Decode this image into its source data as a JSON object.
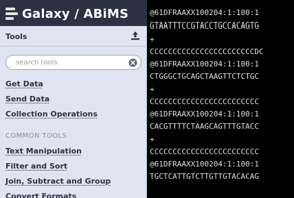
{
  "masthead": {
    "brand": "Galaxy / ABiMS"
  },
  "tool_panel": {
    "title": "Tools",
    "search": {
      "placeholder": "search tools",
      "value": ""
    },
    "links": [
      "Get Data",
      "Send Data",
      "Collection Operations"
    ],
    "section": "COMMON TOOLS",
    "common_tools": [
      "Text Manipulation",
      "Filter and Sort",
      "Join, Subtract and Group",
      "Convert Formats"
    ]
  },
  "dataset": {
    "lines": [
      "@61DFRAAXX100204:1:100:1",
      "GTAATTTCCGTACCTGCCACAGTG",
      "+",
      "CCCCCCCCCCCCCCCCCCCCCCCDC",
      "@61DFRAAXX100204:1:100:1",
      "CTGGGCTGCAGCTAAGTTCTCTGC",
      "+",
      "CCCCCCCCCCCCCCCCCCCCCCCC",
      "@61DFRAAXX100204:1:100:1",
      "CACGTTTTCTAAGCAGTTTGTACC",
      "+",
      "CCCCCCCCCCCCCCCCCCCCCCCC",
      "@61DFRAAXX100204:1:100:1",
      "TGCTCATTGTCTTGTTGTACACAG"
    ]
  },
  "colors": {
    "masthead": "#2c3143",
    "panel": "#dfe5f0",
    "dataset_bg": "#000000",
    "dataset_text": "#e0e0e0"
  },
  "icons": [
    "galaxy-logo-icon",
    "upload-icon",
    "clear-search-icon"
  ]
}
